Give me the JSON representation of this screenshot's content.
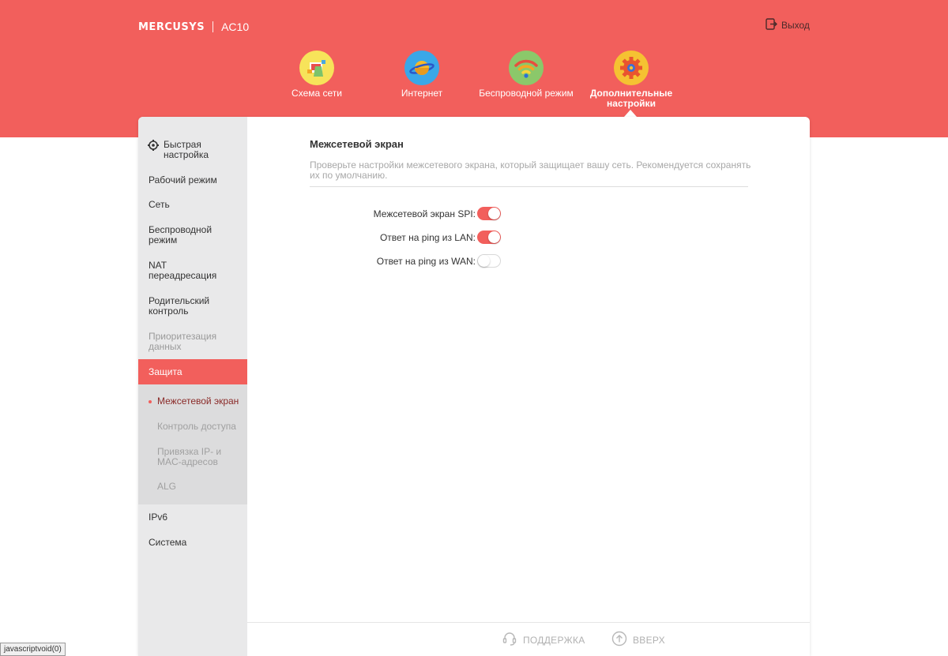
{
  "brand": {
    "logo": "MERCUSYS",
    "model": "AC10"
  },
  "header": {
    "logout_label": "Выход"
  },
  "topnav": [
    {
      "label": "Схема сети",
      "icon": "network-map-icon"
    },
    {
      "label": "Интернет",
      "icon": "planet-icon"
    },
    {
      "label": "Беспроводной режим",
      "icon": "wifi-icon"
    },
    {
      "label": "Дополнительные настройки",
      "icon": "gear-icon",
      "active": true
    }
  ],
  "sidebar": {
    "items": [
      {
        "label": "Быстрая настройка"
      },
      {
        "label": "Рабочий режим"
      },
      {
        "label": "Сеть"
      },
      {
        "label": "Беспроводной режим"
      },
      {
        "label": "NAT переадресация"
      },
      {
        "label": "Родительский контроль"
      },
      {
        "label": "Приоритезация данных"
      },
      {
        "label": "Защита"
      },
      {
        "label": "IPv6"
      },
      {
        "label": "Система"
      }
    ],
    "submenu": [
      {
        "label": "Межсетевой экран"
      },
      {
        "label": "Контроль доступа"
      },
      {
        "label": "Привязка IP- и MAC-адресов"
      },
      {
        "label": "ALG"
      }
    ]
  },
  "main": {
    "title": "Межсетевой экран",
    "description": "Проверьте настройки межсетевого экрана, который защищает вашу сеть. Рекомендуется сохранять их по умолчанию.",
    "settings": [
      {
        "label": "Межсетевой экран SPI:",
        "enabled": true
      },
      {
        "label": "Ответ на ping из LAN:",
        "enabled": true
      },
      {
        "label": "Ответ на ping из WAN:",
        "enabled": false
      }
    ]
  },
  "footer": {
    "support_label": "ПОДДЕРЖКА",
    "top_label": "ВВЕРХ"
  },
  "statusbar": {
    "text": "javascriptvoid(0)"
  },
  "colors": {
    "accent": "#f25f5c",
    "sidebar_bg": "#e9e9ea",
    "submenu_bg": "#dcdcdd"
  }
}
